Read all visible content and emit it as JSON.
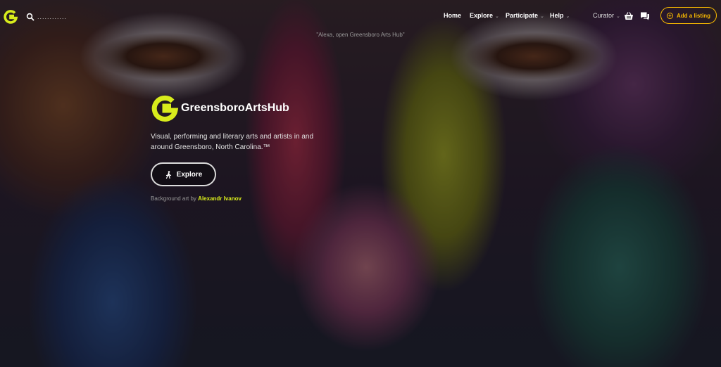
{
  "header": {
    "search": {
      "placeholder": "............"
    },
    "nav": [
      {
        "label": "Home",
        "has_dropdown": false
      },
      {
        "label": "Explore",
        "has_dropdown": true
      },
      {
        "label": "Participate",
        "has_dropdown": true
      },
      {
        "label": "Help",
        "has_dropdown": true
      }
    ],
    "user": {
      "label": "Curator"
    },
    "icons": [
      "basket-icon",
      "chat-icon"
    ],
    "add_listing": {
      "label": "Add a listing"
    }
  },
  "alexa_hint": "\"Alexa, open Greensboro Arts Hub\"",
  "hero": {
    "brand_name": "GreensboroArtsHub",
    "tagline": "Visual, performing and literary arts and artists in and around Greensboro, North Carolina.™",
    "explore_button": "Explore",
    "credit_prefix": "Background art by",
    "credit_artist": "Alexandr Ivanov"
  },
  "colors": {
    "brand_accent": "#d8ec1c",
    "add_listing_accent": "#f5b700"
  }
}
